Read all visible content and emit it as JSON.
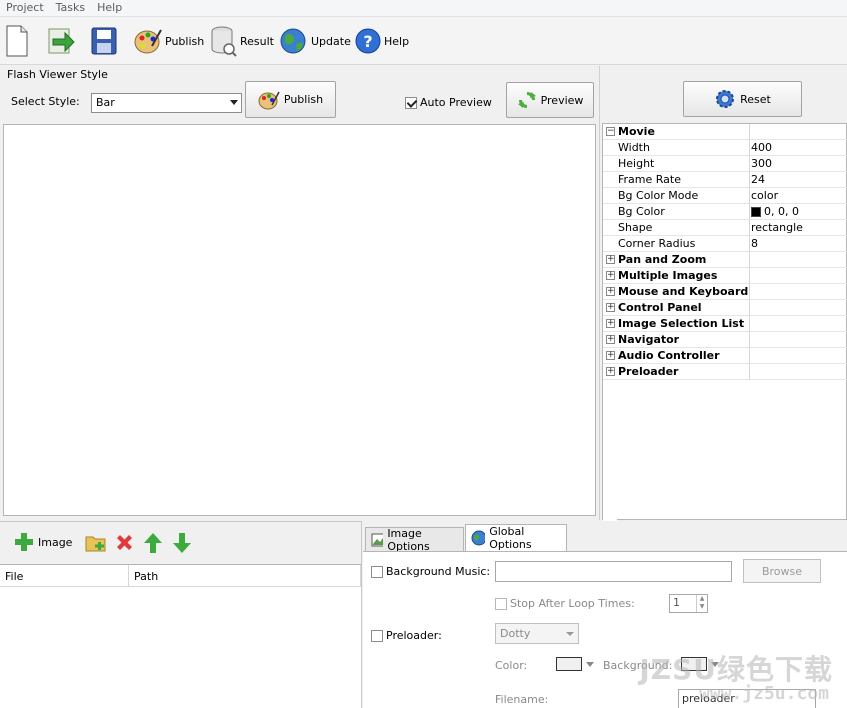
{
  "menu": [
    "Project",
    "Tasks",
    "Help"
  ],
  "toolbar": {
    "publish": "Publish",
    "result": "Result",
    "update": "Update",
    "help": "Help"
  },
  "viewer": {
    "title": "Flash Viewer Style",
    "select_label": "Select Style:",
    "style_value": "Bar",
    "publish_label": "Publish",
    "auto_preview_label": "Auto Preview",
    "auto_preview_checked": true,
    "preview_label": "Preview"
  },
  "properties": {
    "reset_label": "Reset",
    "movie_group": "Movie",
    "rows": [
      {
        "name": "Width",
        "value": "400"
      },
      {
        "name": "Height",
        "value": "300"
      },
      {
        "name": "Frame Rate",
        "value": "24"
      },
      {
        "name": "Bg Color Mode",
        "value": "color"
      },
      {
        "name": "Bg Color",
        "value": "0, 0, 0"
      },
      {
        "name": "Shape",
        "value": "rectangle"
      },
      {
        "name": "Corner Radius",
        "value": "8"
      }
    ],
    "groups": [
      "Pan and Zoom",
      "Multiple Images",
      "Mouse and Keyboard",
      "Control Panel",
      "Image Selection List",
      "Navigator",
      "Audio Controller",
      "Preloader"
    ],
    "bg_color_swatch": "#000000"
  },
  "images": {
    "add_label": "Image",
    "columns": [
      "File",
      "Path"
    ]
  },
  "options": {
    "tab_image": "Image Options",
    "tab_global": "Global Options",
    "background_music_label": "Background Music:",
    "browse_label": "Browse",
    "stop_after_loop_label": "Stop After Loop Times:",
    "loop_times_value": "1",
    "preloader_label": "Preloader:",
    "preloader_style": "Dotty",
    "color_label": "Color:",
    "background_label": "Background:",
    "filename_label": "Filename:",
    "filename_value": "preloader"
  },
  "watermark": {
    "brand": "JZSU绿色下载",
    "url": "www.jz5u.com"
  }
}
